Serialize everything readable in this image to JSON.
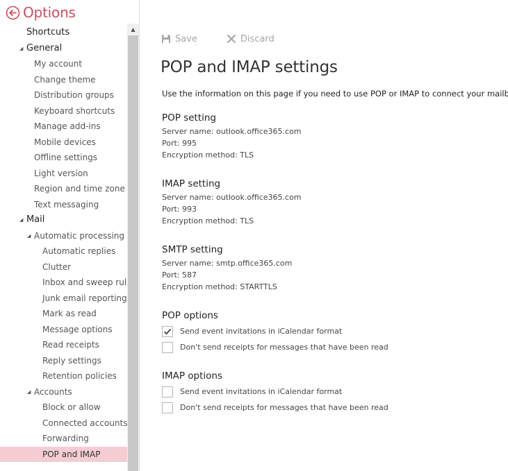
{
  "header": {
    "title": "Options"
  },
  "nav": {
    "items": [
      {
        "label": "Shortcuts",
        "level": 0,
        "caret": "",
        "section": true
      },
      {
        "label": "General",
        "level": 0,
        "caret": "expanded",
        "section": true
      },
      {
        "label": "My account",
        "level": 1
      },
      {
        "label": "Change theme",
        "level": 1
      },
      {
        "label": "Distribution groups",
        "level": 1
      },
      {
        "label": "Keyboard shortcuts",
        "level": 1
      },
      {
        "label": "Manage add-ins",
        "level": 1
      },
      {
        "label": "Mobile devices",
        "level": 1
      },
      {
        "label": "Offline settings",
        "level": 1
      },
      {
        "label": "Light version",
        "level": 1
      },
      {
        "label": "Region and time zone",
        "level": 1
      },
      {
        "label": "Text messaging",
        "level": 1
      },
      {
        "label": "Mail",
        "level": 0,
        "caret": "expanded",
        "section": true
      },
      {
        "label": "Automatic processing",
        "level": 1,
        "caret": "expanded"
      },
      {
        "label": "Automatic replies",
        "level": 2
      },
      {
        "label": "Clutter",
        "level": 2
      },
      {
        "label": "Inbox and sweep rules",
        "level": 2
      },
      {
        "label": "Junk email reporting",
        "level": 2
      },
      {
        "label": "Mark as read",
        "level": 2
      },
      {
        "label": "Message options",
        "level": 2
      },
      {
        "label": "Read receipts",
        "level": 2
      },
      {
        "label": "Reply settings",
        "level": 2
      },
      {
        "label": "Retention policies",
        "level": 2
      },
      {
        "label": "Accounts",
        "level": 1,
        "caret": "expanded"
      },
      {
        "label": "Block or allow",
        "level": 2
      },
      {
        "label": "Connected accounts",
        "level": 2
      },
      {
        "label": "Forwarding",
        "level": 2
      },
      {
        "label": "POP and IMAP",
        "level": 2,
        "selected": true
      }
    ]
  },
  "toolbar": {
    "save_label": "Save",
    "discard_label": "Discard"
  },
  "page": {
    "title": "POP and IMAP settings",
    "intro": "Use the information on this page if you need to use POP or IMAP to connect your mailbox."
  },
  "pop_setting": {
    "title": "POP setting",
    "server": "Server name: outlook.office365.com",
    "port": "Port: 995",
    "encryption": "Encryption method: TLS"
  },
  "imap_setting": {
    "title": "IMAP setting",
    "server": "Server name: outlook.office365.com",
    "port": "Port: 993",
    "encryption": "Encryption method: TLS"
  },
  "smtp_setting": {
    "title": "SMTP setting",
    "server": "Server name: smtp.office365.com",
    "port": "Port: 587",
    "encryption": "Encryption method: STARTTLS"
  },
  "pop_options": {
    "title": "POP options",
    "opt1_label": "Send event invitations in iCalendar format",
    "opt1_checked": true,
    "opt2_label": "Don't send receipts for messages that have been read",
    "opt2_checked": false
  },
  "imap_options": {
    "title": "IMAP options",
    "opt1_label": "Send event invitations in iCalendar format",
    "opt1_checked": false,
    "opt2_label": "Don't send receipts for messages that have been read",
    "opt2_checked": false
  },
  "colors": {
    "accent": "#d14a60",
    "selected_bg": "#f4cdd3",
    "toolbar_disabled": "#a6a6a6"
  }
}
